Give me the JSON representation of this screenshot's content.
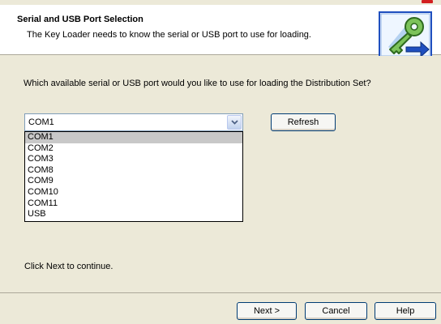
{
  "header": {
    "title": "Serial and USB Port Selection",
    "subtitle": "The Key Loader needs to know the serial or USB port to use for loading."
  },
  "content": {
    "question": "Which available serial or USB port would you like to use for loading the Distribution Set?",
    "combo": {
      "selected": "COM1",
      "icon": "chevron-down-icon"
    },
    "port_options": [
      "COM1",
      "COM2",
      "COM3",
      "COM8",
      "COM9",
      "COM10",
      "COM11",
      "USB"
    ],
    "highlighted_option": "COM1",
    "refresh_label": "Refresh",
    "continue_text": "Click Next to continue."
  },
  "footer": {
    "next_label": "Next >",
    "cancel_label": "Cancel",
    "help_label": "Help"
  },
  "colors": {
    "dialog_bg": "#ece9d8",
    "header_bg": "#ffffff",
    "logo_green": "#7cc35a",
    "logo_blue": "#1f4fbf",
    "highlight": "#c8c8c8"
  }
}
